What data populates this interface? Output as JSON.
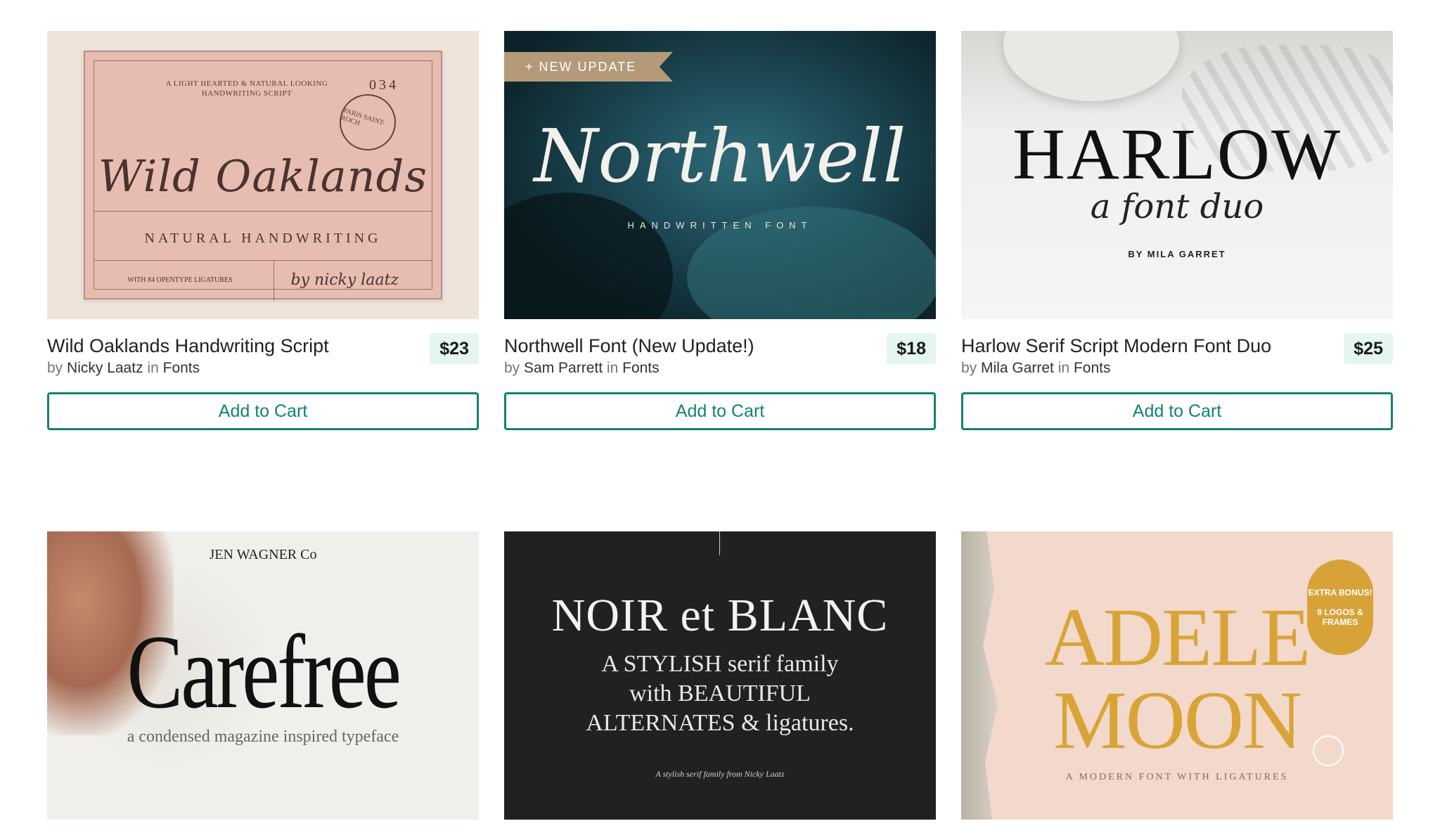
{
  "products": [
    {
      "title": "Wild Oaklands Handwriting Script",
      "price": "$23",
      "by_word": "by",
      "author": "Nicky Laatz",
      "in_word": "in",
      "category": "Fonts",
      "cta": "Add to Cart",
      "thumb": {
        "tagline": "A LIGHT HEARTED & NATURAL LOOKING HANDWRITING SCRIPT",
        "number": "034",
        "stamp": "PARIS SAINT-ROCH",
        "script": "Wild Oaklands",
        "subtitle": "NATURAL HANDWRITING",
        "ligatures": "WITH 84 OPENTYPE LIGATURES",
        "signature": "by nicky laatz"
      }
    },
    {
      "title": "Northwell Font (New Update!)",
      "price": "$18",
      "by_word": "by",
      "author": "Sam Parrett",
      "in_word": "in",
      "category": "Fonts",
      "cta": "Add to Cart",
      "thumb": {
        "ribbon": "+ NEW UPDATE",
        "script": "Northwell",
        "subtitle": "HANDWRITTEN FONT"
      }
    },
    {
      "title": "Harlow Serif Script Modern Font Duo",
      "price": "$25",
      "by_word": "by",
      "author": "Mila Garret",
      "in_word": "in",
      "category": "Fonts",
      "cta": "Add to Cart",
      "thumb": {
        "big": "HARLOW",
        "script": "a font duo",
        "by": "BY MILA GARRET"
      }
    },
    {
      "thumb": {
        "brand": "JEN WAGNER Co",
        "big": "Carefree",
        "subtitle": "a condensed magazine inspired typeface"
      }
    },
    {
      "thumb": {
        "big": "NOIR et BLANC",
        "line1": "A STYLISH serif family",
        "line2": "with BEAUTIFUL",
        "line3": "ALTERNATES & ligatures.",
        "small": "A stylish serif family from Nicky Laatz"
      }
    },
    {
      "thumb": {
        "line1": "ADELE",
        "line2": "MOON",
        "subtitle": "A MODERN FONT WITH LIGATURES",
        "badge_top": "EXTRA BONUS!",
        "badge_bottom": "9 LOGOS & FRAMES"
      }
    }
  ],
  "colors": {
    "accent": "#138272",
    "price_bg": "#e4f5f2"
  }
}
